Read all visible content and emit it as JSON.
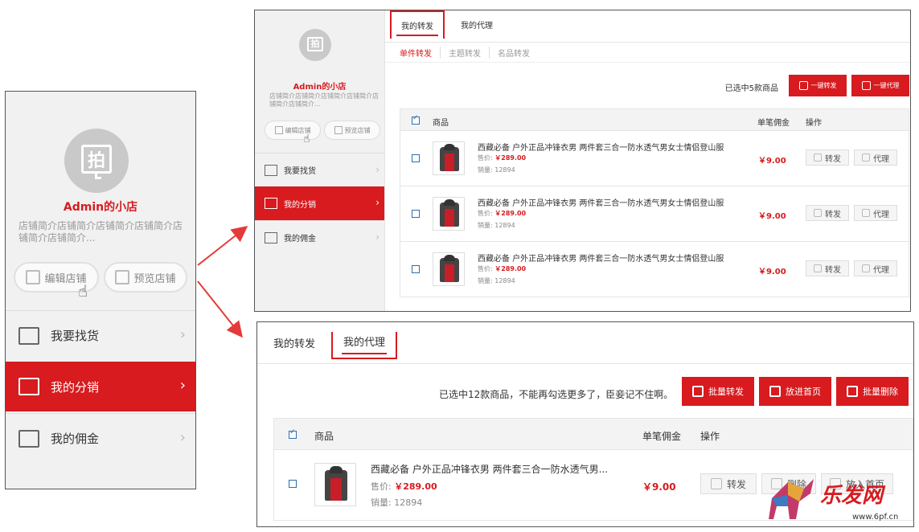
{
  "shop": {
    "name": "Admin的小店",
    "desc": "店铺简介店铺简介店铺简介店铺简介店铺简介店铺简介...",
    "avatar_char": "拍",
    "edit_label": "编辑店铺",
    "preview_label": "预览店铺"
  },
  "menu": [
    {
      "label": "我要找货",
      "icon": "cart-icon"
    },
    {
      "label": "我的分销",
      "icon": "bag-icon"
    },
    {
      "label": "我的佣金",
      "icon": "yen-icon"
    }
  ],
  "top_panel": {
    "tabs": [
      "我的转发",
      "我的代理"
    ],
    "subtabs": [
      "单件转发",
      "主题转发",
      "名品转发"
    ],
    "selected_text": "已选中5款商品",
    "share_all": "一键转发",
    "agent_all": "一键代理",
    "headers": {
      "product": "商品",
      "commission": "单笔佣金",
      "action": "操作"
    },
    "rows": [
      {
        "title": "西藏必备 户外正品冲锋衣男 两件套三合一防水透气男女士情侣登山服",
        "price_label": "售价:",
        "price": "￥289.00",
        "sales_label": "销量:",
        "sales": "12894",
        "commission": "￥9.00",
        "share": "转发",
        "agent": "代理"
      },
      {
        "title": "西藏必备 户外正品冲锋衣男 两件套三合一防水透气男女士情侣登山服",
        "price_label": "售价:",
        "price": "￥289.00",
        "sales_label": "销量:",
        "sales": "12894",
        "commission": "￥9.00",
        "share": "转发",
        "agent": "代理"
      },
      {
        "title": "西藏必备 户外正品冲锋衣男 两件套三合一防水透气男女士情侣登山服",
        "price_label": "售价:",
        "price": "￥289.00",
        "sales_label": "销量:",
        "sales": "12894",
        "commission": "￥9.00",
        "share": "转发",
        "agent": "代理"
      }
    ]
  },
  "bottom_panel": {
    "tabs": [
      "我的转发",
      "我的代理"
    ],
    "selected_text": "已选中12款商品，不能再勾选更多了，臣妾记不住啊。",
    "batch_share": "批量转发",
    "put_home": "放进首页",
    "batch_delete": "批量删除",
    "headers": {
      "product": "商品",
      "commission": "单笔佣金",
      "action": "操作"
    },
    "row": {
      "title": "西藏必备 户外正品冲锋衣男 两件套三合一防水透气男...",
      "price_label": "售价:",
      "price": "￥289.00",
      "sales_label": "销量:",
      "sales": "12894",
      "commission": "￥9.00",
      "share": "转发",
      "delete": "删除",
      "home": "放入首页"
    }
  },
  "watermark": {
    "logo": "乐发网",
    "url": "www.6pf.cn"
  },
  "colors": {
    "accent": "#d71b1f",
    "sidebar_bg": "#f1f1f1",
    "checkbox": "#2a6fb0"
  }
}
